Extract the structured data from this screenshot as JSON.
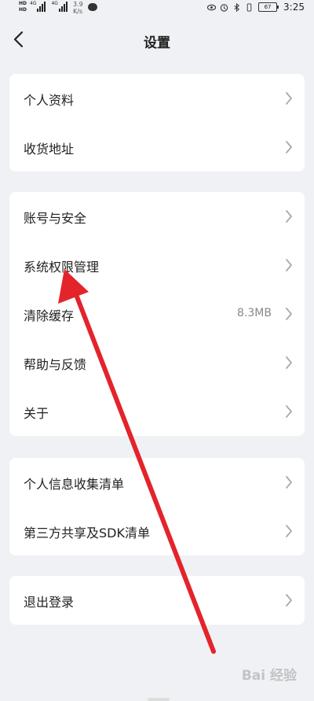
{
  "status_bar": {
    "hd1": "HD",
    "hd2": "HD",
    "net1": "4G",
    "net2": "4G",
    "speed_value": "3.9",
    "speed_unit": "K/s",
    "battery": "67",
    "time": "3:25"
  },
  "header": {
    "title": "设置"
  },
  "groups": [
    {
      "items": [
        {
          "label": "个人资料"
        },
        {
          "label": "收货地址"
        }
      ]
    },
    {
      "items": [
        {
          "label": "账号与安全"
        },
        {
          "label": "系统权限管理"
        },
        {
          "label": "清除缓存",
          "value": "8.3MB"
        },
        {
          "label": "帮助与反馈"
        },
        {
          "label": "关于"
        }
      ]
    },
    {
      "items": [
        {
          "label": "个人信息收集清单"
        },
        {
          "label": "第三方共享及SDK清单"
        }
      ]
    },
    {
      "items": [
        {
          "label": "退出登录"
        }
      ]
    }
  ],
  "watermark": "Bai 经验",
  "annotation": {
    "arrow_color": "#e3242b"
  }
}
